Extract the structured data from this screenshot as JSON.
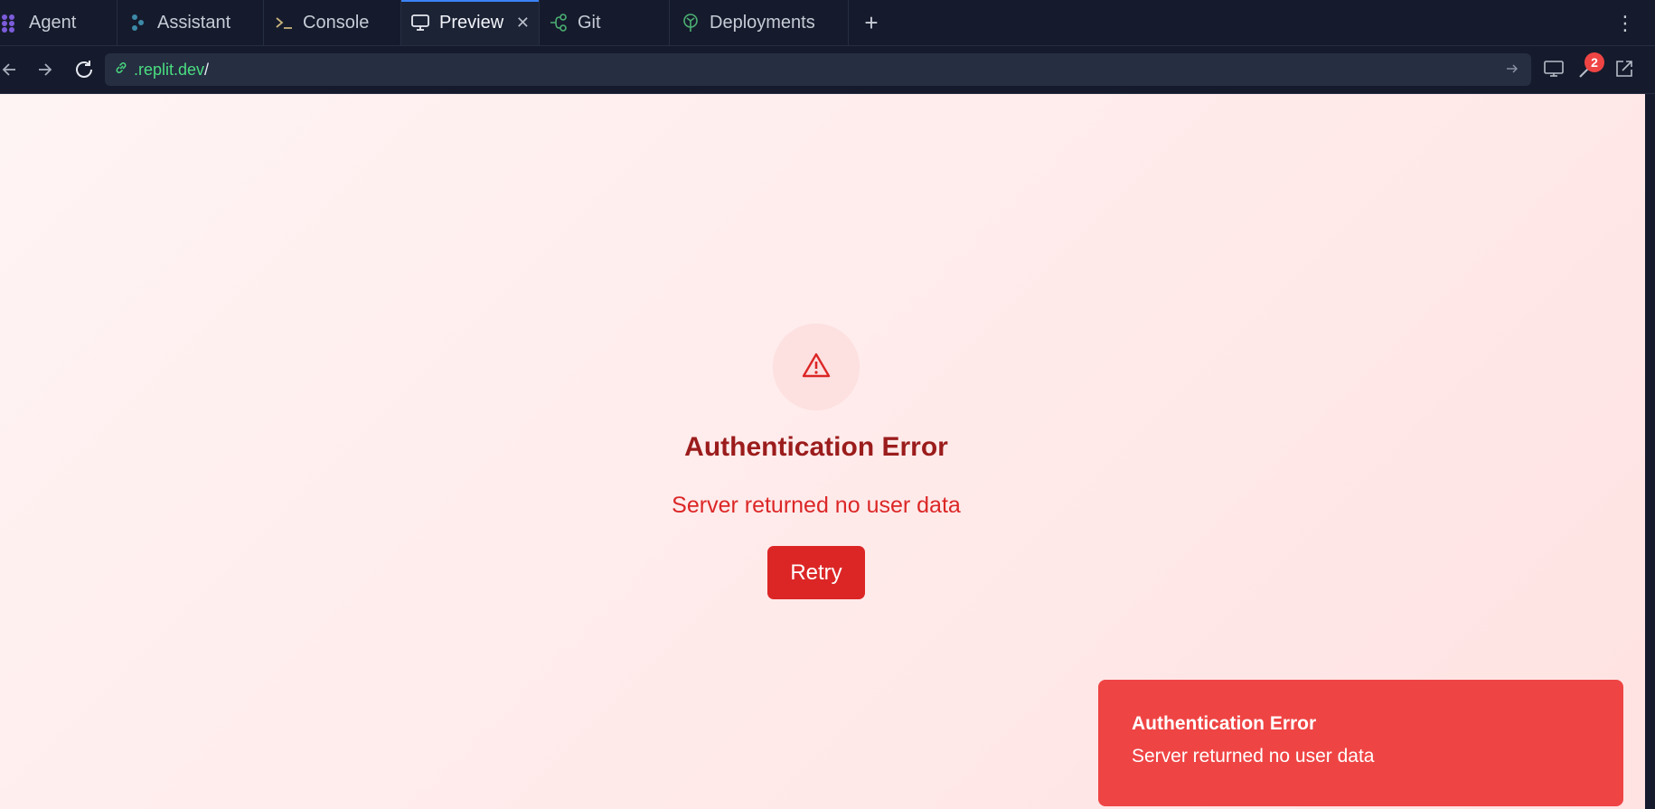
{
  "tabs": [
    {
      "label": "Agent",
      "icon": "agent-icon"
    },
    {
      "label": "Assistant",
      "icon": "assistant-icon"
    },
    {
      "label": "Console",
      "icon": "console-icon"
    },
    {
      "label": "Preview",
      "icon": "monitor-icon",
      "active": true
    },
    {
      "label": "Git",
      "icon": "git-icon"
    },
    {
      "label": "Deployments",
      "icon": "deployments-icon"
    }
  ],
  "address_bar": {
    "url_domain": ".replit.dev",
    "url_path": "/"
  },
  "devtools_badge": "2",
  "error_page": {
    "icon": "warning-triangle-icon",
    "title": "Authentication Error",
    "message": "Server returned no user data",
    "retry_label": "Retry"
  },
  "toast": {
    "title": "Authentication Error",
    "message": "Server returned no user data"
  },
  "colors": {
    "accent_blue": "#3b82f6",
    "error_red": "#dc2626",
    "error_dark": "#9b1c1c",
    "toast_bg": "#ef4444",
    "url_green": "#4ade80"
  }
}
